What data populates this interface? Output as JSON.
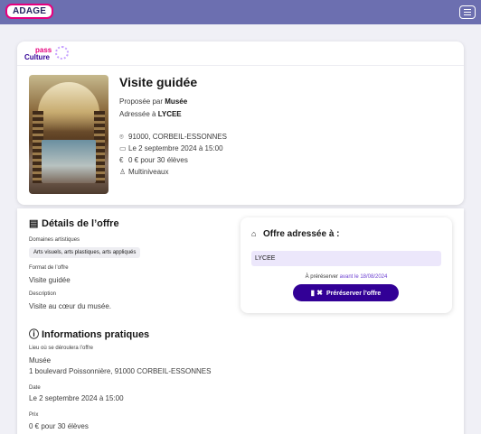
{
  "header": {
    "logo": "ADAGE",
    "menu_icon": "hamburger-icon",
    "bg_color": "#6c6fb0"
  },
  "brand": {
    "pass": "pass",
    "culture": "Culture"
  },
  "offer": {
    "title": "Visite guidée",
    "proposed_prefix": "Proposée par ",
    "proposed_by": "Musée",
    "addressed_prefix": "Adressée à ",
    "addressed_to": "LYCEE",
    "location": "91000, CORBEIL-ESSONNES",
    "date": "Le 2 septembre 2024 à 15:00",
    "price": "0 € pour 30 élèves",
    "level": "Multiniveaux"
  },
  "details": {
    "title": "Détails de l’offre",
    "domains_label": "Domaines artistiques",
    "domains_value": "Arts visuels, arts plastiques, arts appliqués",
    "format_label": "Format de l’offre",
    "format_value": "Visite guidée",
    "description_label": "Description",
    "description_value": "Visite au cœur du musée."
  },
  "practical": {
    "title": "Informations pratiques",
    "place_label": "Lieu où se déroulera l’offre",
    "place_name": "Musée",
    "place_address": "1 boulevard Poissonnière, 91000 CORBEIL-ESSONNES",
    "date_label": "Date",
    "date_value": "Le 2 septembre 2024 à 15:00",
    "price_label": "Prix",
    "price_value": "0 € pour 30 élèves"
  },
  "booking": {
    "title": "Offre adressée à :",
    "school": "LYCEE",
    "deadline_prefix": "À préréserver ",
    "deadline": "avant le 18/08/2024",
    "button_label": "Préréserver l’offre",
    "accent_color": "#320096"
  }
}
